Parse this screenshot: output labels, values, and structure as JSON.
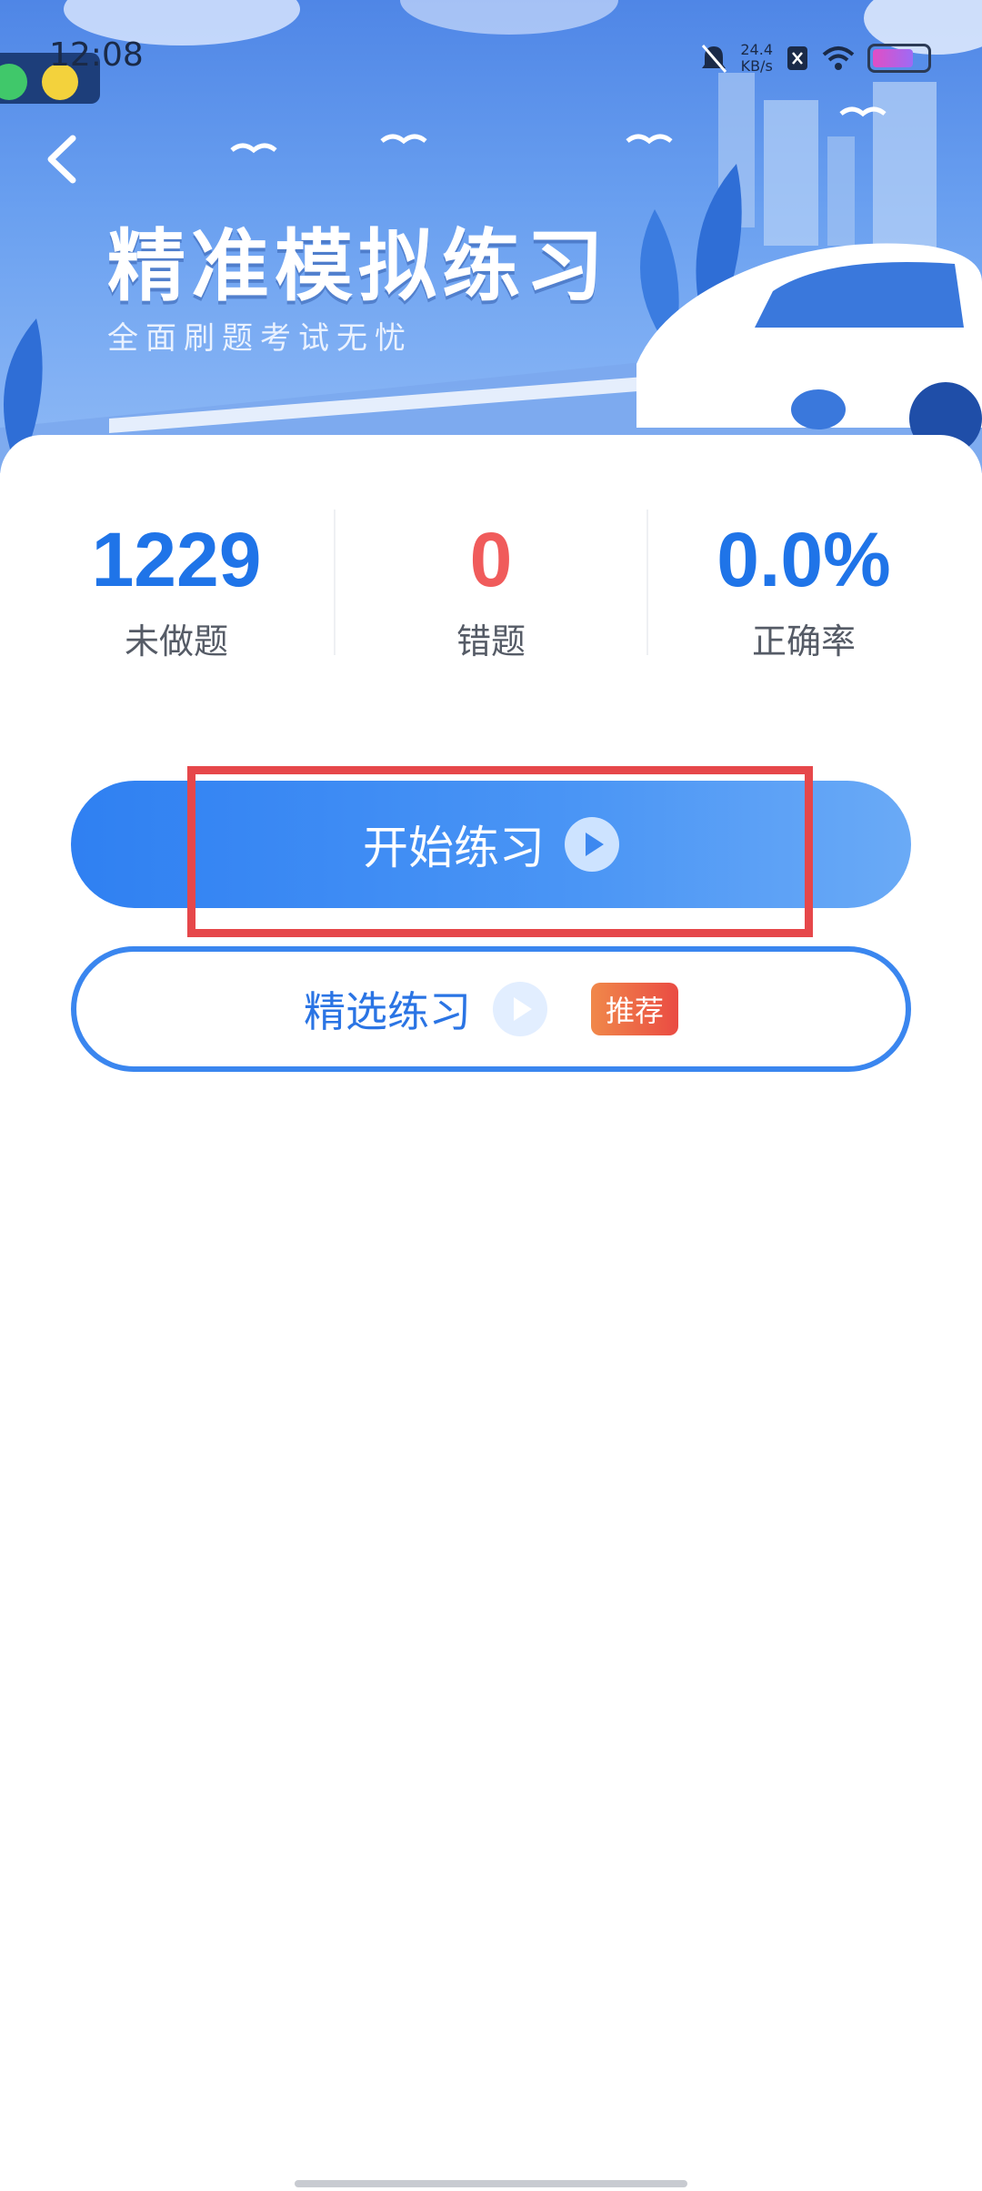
{
  "status_bar": {
    "time": "12:08",
    "net_speed_value": "24.4",
    "net_speed_unit": "KB/s"
  },
  "banner": {
    "title": "精准模拟练习",
    "subtitle": "全面刷题考试无忧"
  },
  "stats": [
    {
      "value": "1229",
      "label": "未做题"
    },
    {
      "value": "0",
      "label": "错题"
    },
    {
      "value": "0.0%",
      "label": "正确率"
    }
  ],
  "buttons": {
    "start_label": "开始练习",
    "select_label": "精选练习",
    "select_badge": "推荐"
  },
  "colors": {
    "primary": "#1f74e8",
    "error": "#f05b5b",
    "highlight": "#e6474a"
  }
}
